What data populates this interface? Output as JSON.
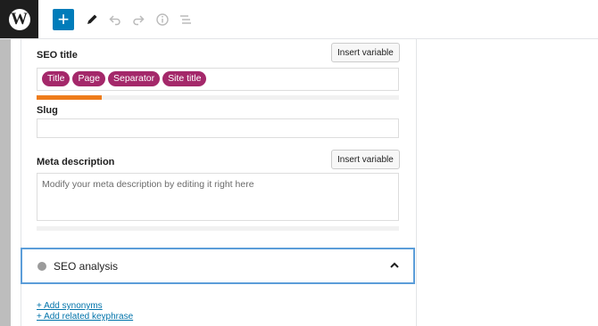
{
  "toolbar": {
    "logo_text": "W",
    "add_symbol": "+",
    "icons": [
      "wordpress-icon",
      "plus-icon",
      "pencil-icon",
      "undo-icon",
      "redo-icon",
      "info-icon",
      "list-view-icon"
    ]
  },
  "seo_title": {
    "label": "SEO title",
    "insert_button": "Insert variable",
    "pills": [
      "Title",
      "Page",
      "Separator",
      "Site title"
    ],
    "progress_fraction": 0.18,
    "progress_color": "#ee7c1b"
  },
  "slug": {
    "label": "Slug",
    "value": ""
  },
  "meta_description": {
    "label": "Meta description",
    "insert_button": "Insert variable",
    "placeholder": "Modify your meta description by editing it right here",
    "progress_fraction": 0
  },
  "seo_analysis": {
    "title": "SEO analysis",
    "status_color": "#9b9b9b"
  },
  "links": {
    "add_synonyms": "+ Add synonyms",
    "add_related_keyphrase": "+ Add related keyphrase"
  },
  "colors": {
    "accent": "#007cba",
    "pill": "#a4286a",
    "focus_border": "#5b9dd9",
    "link": "#0073aa"
  }
}
